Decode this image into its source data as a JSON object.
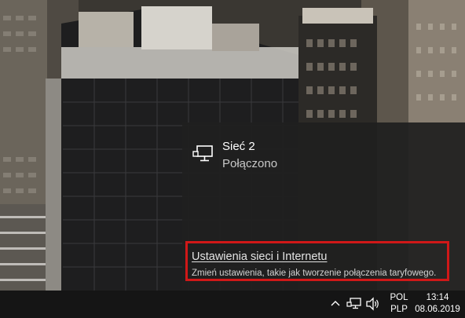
{
  "flyout": {
    "network_name": "Sieć 2",
    "network_status": "Połączono",
    "settings_link": "Ustawienia sieci i Internetu",
    "settings_description": "Zmień ustawienia, takie jak tworzenie połączenia taryfowego."
  },
  "taskbar": {
    "language_top": "POL",
    "language_bottom": "PLP",
    "time": "13:14",
    "date": "08.06.2019"
  },
  "icons": {
    "network": "ethernet-monitor-icon",
    "tray_chevron": "chevron-up-icon",
    "tray_network": "network-icon",
    "tray_volume": "speaker-icon"
  },
  "colors": {
    "highlight_border": "#d01818",
    "flyout_bg": "#1f1f1f",
    "taskbar_bg": "#151515"
  }
}
